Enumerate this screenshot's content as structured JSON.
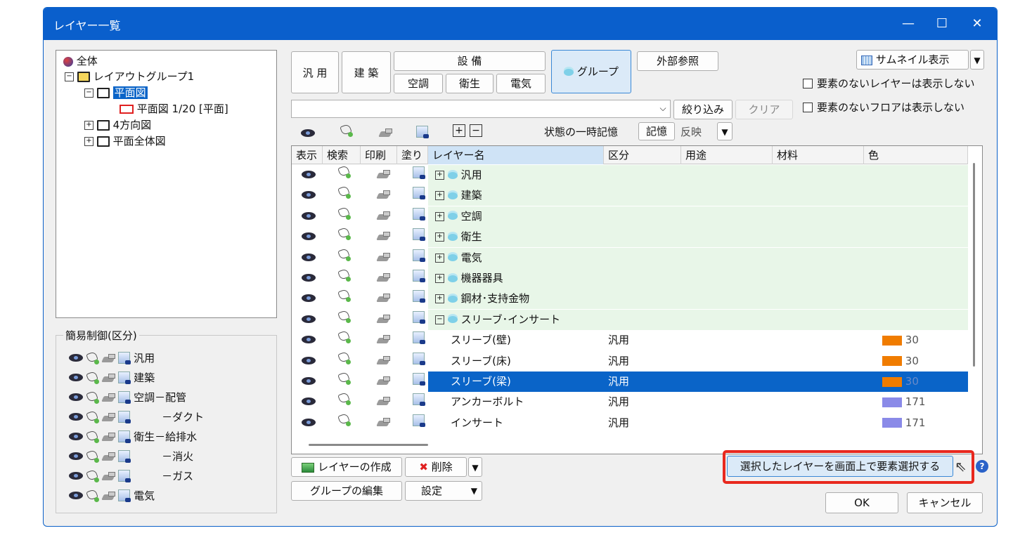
{
  "window": {
    "title": "レイヤー一覧",
    "controls": [
      "—",
      "☐",
      "✕"
    ]
  },
  "tree": {
    "root": "全体",
    "group": "レイアウトグループ1",
    "selected": "平面図",
    "child": "平面図 1/20 [平面]",
    "items": [
      "4方向図",
      "平面全体図"
    ]
  },
  "simple_control": {
    "title": "簡易制御(区分)",
    "rows": [
      "汎用",
      "建築",
      "空調－配管",
      "－ダクト",
      "衛生－給排水",
      "－消火",
      "－ガス",
      "電気"
    ]
  },
  "categories": {
    "general": "汎 用",
    "architecture": "建 築",
    "equipment": "設 備",
    "hvac": "空調",
    "sanitary": "衛生",
    "electric": "電気",
    "group": "グループ",
    "external_ref": "外部参照"
  },
  "thumbnail": {
    "label": "サムネイル表示"
  },
  "options": {
    "hide_empty_layers": "要素のないレイヤーは表示しない",
    "hide_empty_floors": "要素のないフロアは表示しない"
  },
  "filter": {
    "value": "",
    "narrow": "絞り込み",
    "clear": "クリア"
  },
  "state_memory": {
    "label": "状態の一時記憶",
    "save": "記憶",
    "apply": "反映"
  },
  "columns": [
    "表示",
    "検索",
    "印刷",
    "塗り",
    "レイヤー名",
    "区分",
    "用途",
    "材料",
    "色"
  ],
  "groups": [
    "汎用",
    "建築",
    "空調",
    "衛生",
    "電気",
    "機器器具",
    "鋼材･支持金物",
    "スリーブ･インサート"
  ],
  "layers": [
    {
      "name": "スリーブ(壁)",
      "category": "汎用",
      "color": "#f07c00",
      "color_no": "30",
      "selected": false
    },
    {
      "name": "スリーブ(床)",
      "category": "汎用",
      "color": "#f07c00",
      "color_no": "30",
      "selected": false
    },
    {
      "name": "スリーブ(梁)",
      "category": "汎用",
      "color": "#f07c00",
      "color_no": "30",
      "selected": true
    },
    {
      "name": "アンカーボルト",
      "category": "汎用",
      "color": "#8a8ae8",
      "color_no": "171",
      "selected": false
    },
    {
      "name": "インサート",
      "category": "汎用",
      "color": "#8a8ae8",
      "color_no": "171",
      "selected": false
    }
  ],
  "bottom": {
    "create_layer": "レイヤーの作成",
    "delete": "削除",
    "edit_group": "グループの編集",
    "settings": "設定",
    "select_on_screen": "選択したレイヤーを画面上で要素選択する",
    "ok": "OK",
    "cancel": "キャンセル"
  },
  "accent": {
    "title_bar": "#0a5fcc",
    "selection": "#0a64c8",
    "highlight": "#e8281e",
    "group_bg": "#e8f6e8"
  }
}
